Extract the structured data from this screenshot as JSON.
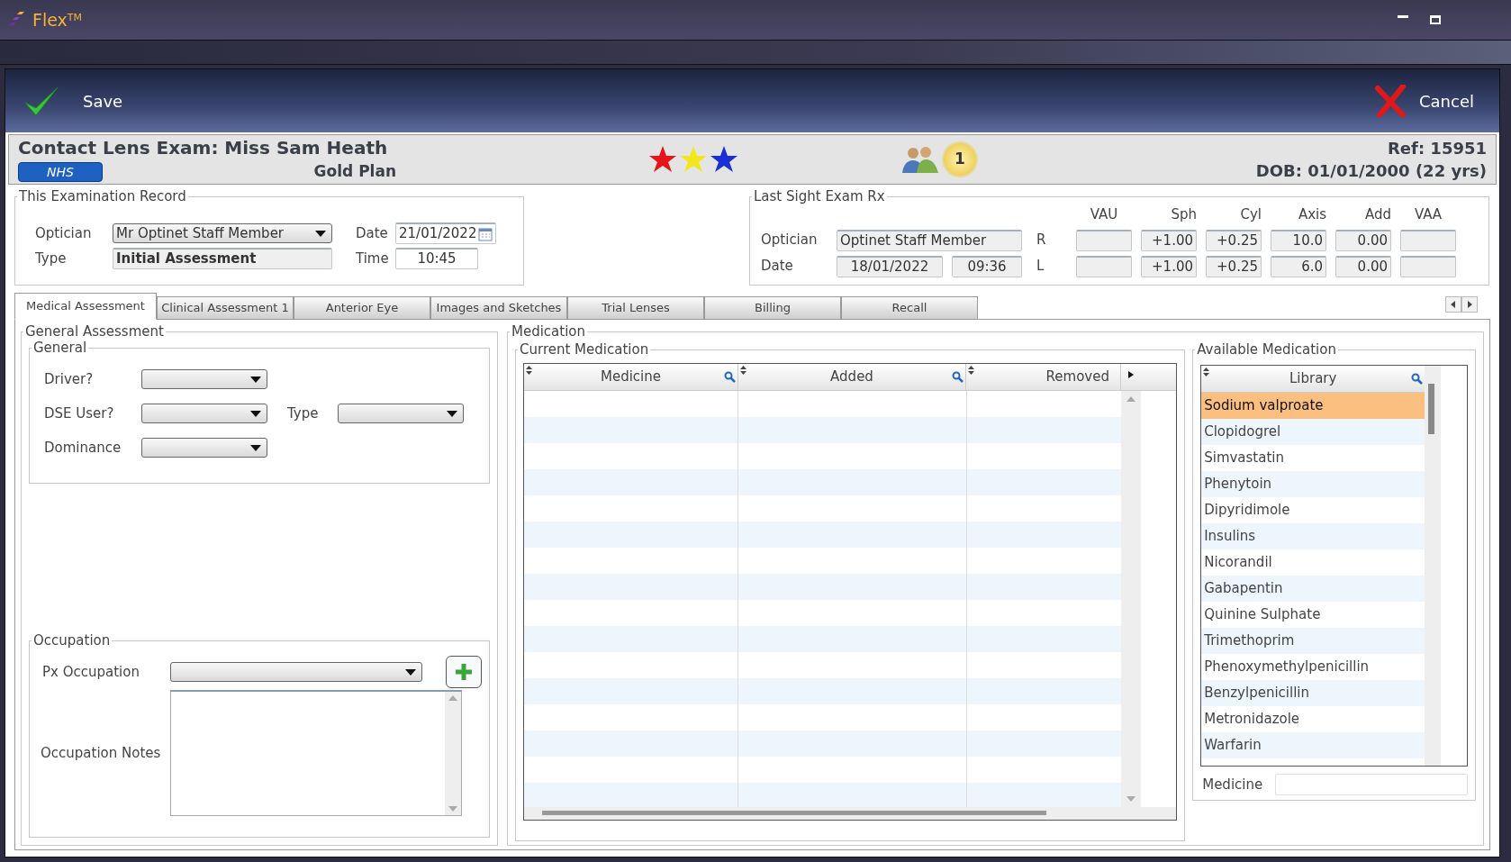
{
  "window": {
    "title": "Flex$^{TM}$"
  },
  "toolbar": {
    "save": "Save",
    "cancel": "Cancel"
  },
  "header": {
    "title": "Contact Lens Exam: Miss Sam Heath",
    "badge": "NHS",
    "plan": "Gold Plan",
    "flags": [
      {
        "color": "#e8141b"
      },
      {
        "color": "#f2e71c"
      },
      {
        "color": "#1b2fd6"
      }
    ],
    "count": "1",
    "ref": "Ref: 15951",
    "dob": "DOB: 01/01/2000 (22 yrs)"
  },
  "exam_record": {
    "legend": "This Examination Record",
    "optician_label": "Optician",
    "optician": "Mr Optinet Staff Member",
    "date_label": "Date",
    "date": "21/01/2022",
    "type_label": "Type",
    "type": "Initial Assessment",
    "time_label": "Time",
    "time": "10:45"
  },
  "last_rx": {
    "legend": "Last Sight Exam Rx",
    "optician_label": "Optician",
    "optician": "Optinet Staff Member",
    "date_label": "Date",
    "date": "18/01/2022",
    "time": "09:36",
    "columns": [
      "VAU",
      "Sph",
      "Cyl",
      "Axis",
      "Add",
      "VAA"
    ],
    "rows": [
      {
        "eye": "R",
        "values": [
          "+1.00",
          "+0.25",
          "10.0",
          "0.00"
        ]
      },
      {
        "eye": "L",
        "values": [
          "+1.00",
          "+0.25",
          "6.0",
          "0.00"
        ]
      }
    ]
  },
  "tabs": [
    {
      "label": "Medical Assessment",
      "selected": true
    },
    {
      "label": "Clinical Assessment 1",
      "selected": false
    },
    {
      "label": "Anterior Eye",
      "selected": false
    },
    {
      "label": "Images and Sketches",
      "selected": false
    },
    {
      "label": "Trial Lenses",
      "selected": false
    },
    {
      "label": "Billing",
      "selected": false
    },
    {
      "label": "Recall",
      "selected": false
    }
  ],
  "general_assessment": {
    "legend": "General Assessment",
    "general_legend": "General",
    "rows": [
      [
        {
          "label": "Driver?"
        }
      ],
      [
        {
          "label": "DSE User?"
        },
        {
          "label": "Type"
        }
      ],
      [
        {
          "label": "Dominance"
        }
      ]
    ],
    "occupation": {
      "legend": "Occupation",
      "px_label": "Px Occupation",
      "notes_label": "Occupation Notes"
    }
  },
  "medication": {
    "legend": "Medication",
    "current_legend": "Current Medication",
    "columns": [
      "Medicine",
      "Added",
      "Removed"
    ],
    "available_legend": "Available Medication",
    "library_column": "Library",
    "library": [
      {
        "name": "Sodium valproate",
        "selected": true
      },
      {
        "name": "Clopidogrel",
        "selected": false
      },
      {
        "name": "Simvastatin",
        "selected": false
      },
      {
        "name": "Phenytoin",
        "selected": false
      },
      {
        "name": "Dipyridimole",
        "selected": false
      },
      {
        "name": "Insulins",
        "selected": false
      },
      {
        "name": "Nicorandil",
        "selected": false
      },
      {
        "name": "Gabapentin",
        "selected": false
      },
      {
        "name": "Quinine Sulphate",
        "selected": false
      },
      {
        "name": "Trimethoprim",
        "selected": false
      },
      {
        "name": "Phenoxymethylpenicillin",
        "selected": false
      },
      {
        "name": "Benzylpenicillin",
        "selected": false
      },
      {
        "name": "Metronidazole",
        "selected": false
      },
      {
        "name": "Warfarin",
        "selected": false
      }
    ],
    "search_label": "Medicine"
  }
}
